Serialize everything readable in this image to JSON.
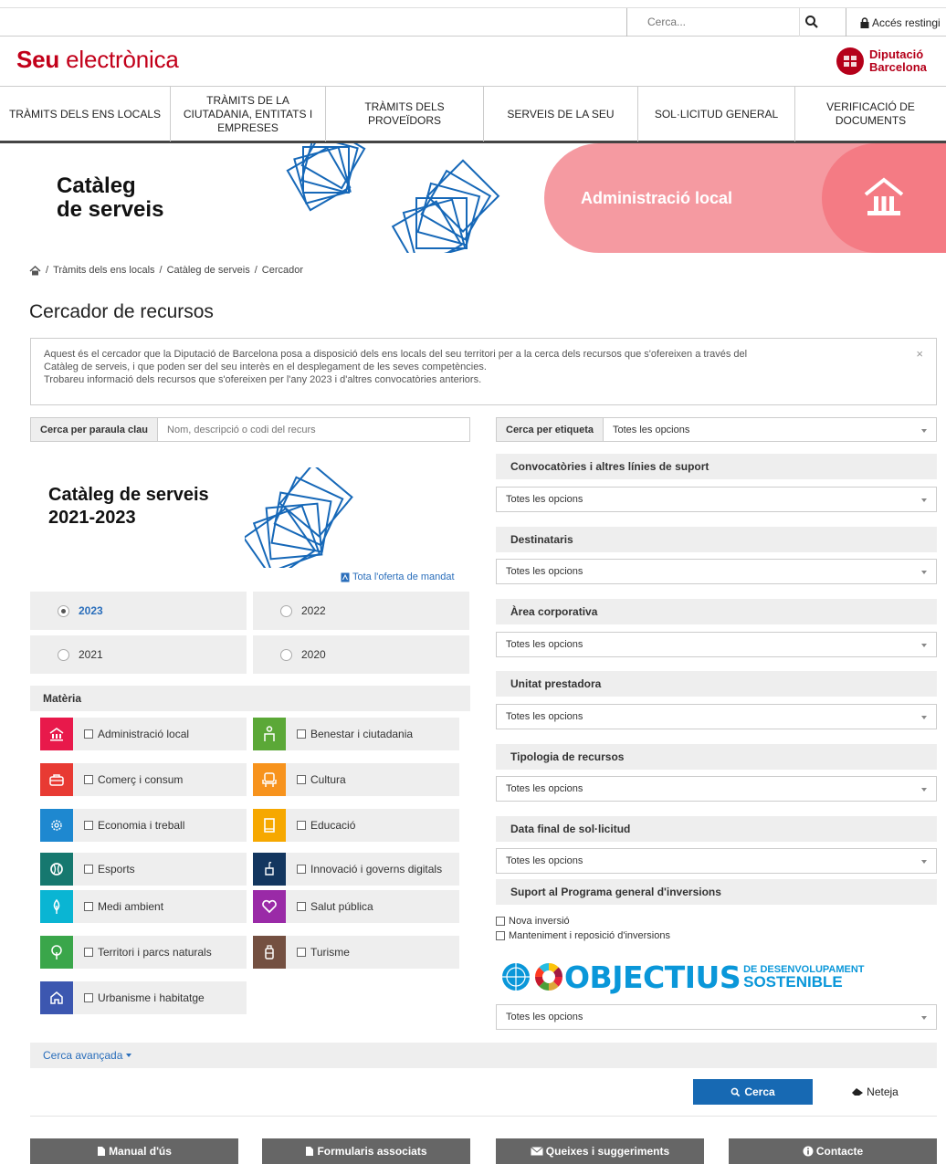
{
  "topbar": {
    "search_placeholder": "Cerca...",
    "restricted_label": "Accés restingi"
  },
  "brand": {
    "bold": "Seu",
    "light": " electrònica"
  },
  "diba": {
    "line1": "Diputació",
    "line2": "Barcelona"
  },
  "nav": [
    "TRÀMITS DELS ENS LOCALS",
    "TRÀMITS DE LA CIUTADANIA, ENTITATS I EMPRESES",
    "TRÀMITS DELS PROVEÏDORS",
    "SERVEIS DE LA SEU",
    "SOL·LICITUD GENERAL",
    "VERIFICACIÓ DE DOCUMENTS"
  ],
  "hero": {
    "title_line1": "Catàleg",
    "title_line2": "de serveis",
    "pink_label": "Administració local"
  },
  "breadcrumb": [
    "Tràmits dels ens locals",
    "Catàleg de serveis",
    "Cercador"
  ],
  "page_title": "Cercador de recursos",
  "info": {
    "line1": "Aquest és el cercador que la Diputació de Barcelona posa a disposició dels ens locals del seu territori per a la cerca dels recursos que s'ofereixen a través del",
    "line2": "Catàleg de serveis, i que poden ser del seu interès en el desplegament de les seves competències.",
    "line3": "Trobareu informació dels recursos que s'ofereixen per l'any 2023 i d'altres convocatòries anteriors.",
    "close": "×"
  },
  "keyword": {
    "label": "Cerca per paraula clau",
    "placeholder": "Nom, descripció o codi del recurs"
  },
  "catalog": {
    "line1": "Catàleg de serveis",
    "line2": "2021-2023",
    "pdf_link": "Tota l'oferta de mandat"
  },
  "years": {
    "y2023": "2023",
    "y2022": "2022",
    "y2021": "2021",
    "y2020": "2020",
    "selected": "2023"
  },
  "materia": {
    "heading": "Matèria",
    "items": [
      {
        "label": "Administració local",
        "color": "#e8194b"
      },
      {
        "label": "Benestar i ciutadania",
        "color": "#5ba837"
      },
      {
        "label": "Comerç i consum",
        "color": "#e83a33"
      },
      {
        "label": "Cultura",
        "color": "#f7931d"
      },
      {
        "label": "Economia i treball",
        "color": "#1e88d0"
      },
      {
        "label": "Educació",
        "color": "#f6a800"
      },
      {
        "label": "Esports",
        "color": "#16786f"
      },
      {
        "label": "Innovació i governs digitals",
        "color": "#13365f"
      },
      {
        "label": "Medi ambient",
        "color": "#0ab5d3"
      },
      {
        "label": "Salut pública",
        "color": "#9a2aa7"
      },
      {
        "label": "Territori i parcs naturals",
        "color": "#3aa64a"
      },
      {
        "label": "Turisme",
        "color": "#745041"
      },
      {
        "label": "Urbanisme i habitatge",
        "color": "#3c57b0"
      }
    ]
  },
  "filters": {
    "tag_label": "Cerca per etiqueta",
    "all_options": "Totes les opcions",
    "convocatories": "Convocatòries i altres línies de suport",
    "destinataris": "Destinataris",
    "area": "Àrea corporativa",
    "unitat": "Unitat prestadora",
    "tipologia": "Tipologia de recursos",
    "data_final": "Data final de sol·licitud",
    "suport": "Suport al Programa general d'inversions",
    "nova": "Nova inversió",
    "manteniment": "Manteniment i reposició d'inversions"
  },
  "ods": {
    "big": "OBJECTIUS",
    "small1": "DE DESENVOLUPAMENT",
    "small2": "SOSTENIBLE"
  },
  "advanced": "Cerca avançada",
  "buttons": {
    "search": "Cerca",
    "clear": "Neteja"
  },
  "footer": [
    "Manual d'ús",
    "Formularis associats",
    "Queixes i suggeriments",
    "Contacte"
  ]
}
